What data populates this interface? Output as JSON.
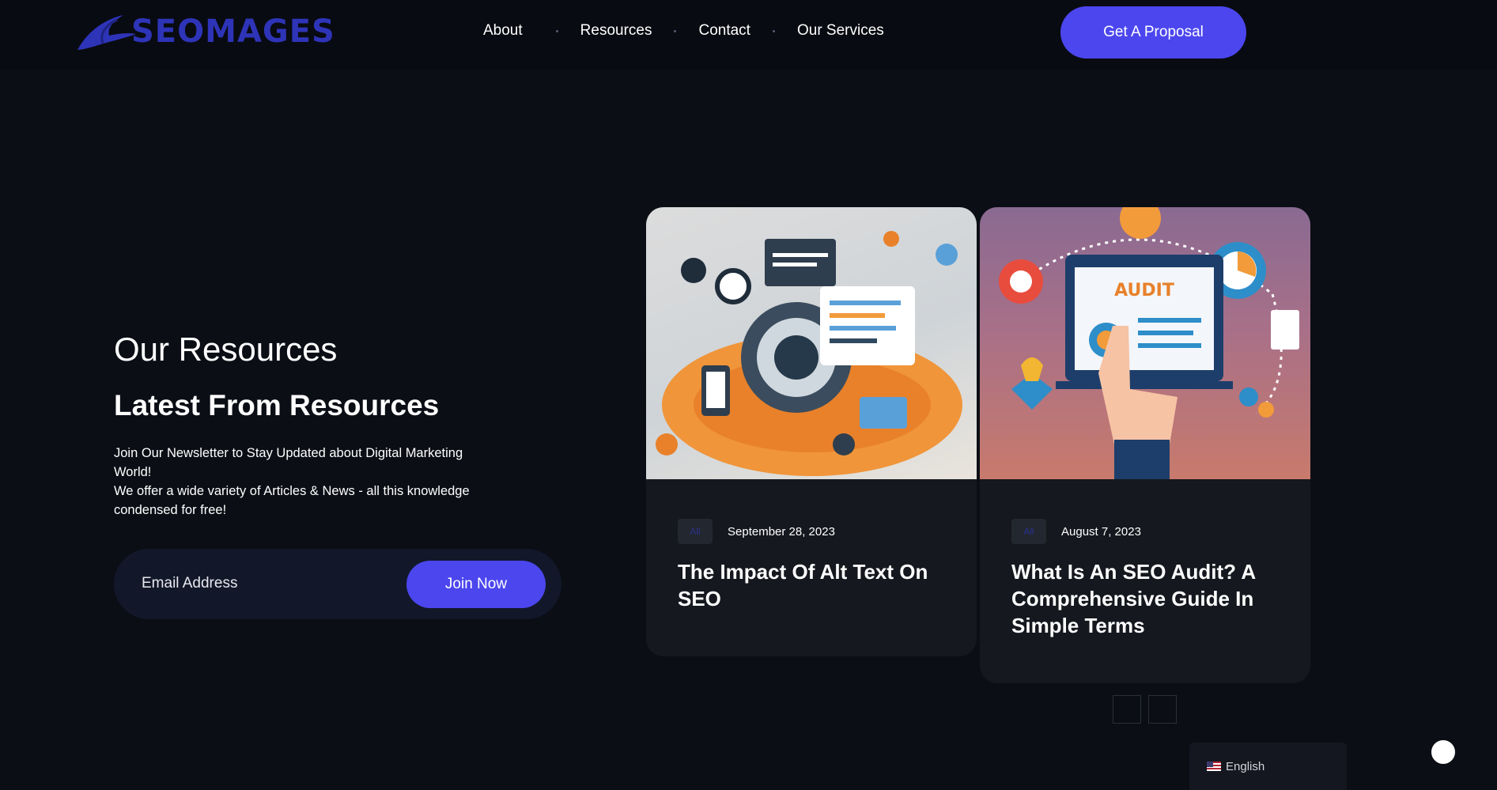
{
  "header": {
    "logo_text": "SEOMAGES",
    "nav": [
      {
        "label": "About"
      },
      {
        "label": "Resources"
      },
      {
        "label": "Contact"
      },
      {
        "label": "Our Services"
      }
    ],
    "cta_label": "Get A Proposal"
  },
  "intro": {
    "subtitle": "Our Resources",
    "title": "Latest From Resources",
    "line1": "Join Our Newsletter to Stay Updated about Digital Marketing World!",
    "line2": "We offer a wide variety of Articles & News - all this knowledge condensed for free!"
  },
  "newsletter": {
    "placeholder": "Email Address",
    "button_label": "Join Now"
  },
  "cards": [
    {
      "tag": "All",
      "date": "September 28, 2023",
      "title": "The Impact Of Alt Text On SEO"
    },
    {
      "tag": "All",
      "date": "August 7, 2023",
      "title": "What Is An SEO Audit? A Comprehensive Guide In Simple Terms",
      "image_text": "AUDIT"
    }
  ],
  "language": {
    "label": "English",
    "icon": "us-flag-icon"
  },
  "colors": {
    "accent": "#4b46ee",
    "logo": "#2e34b8",
    "background": "#0b0e15"
  }
}
